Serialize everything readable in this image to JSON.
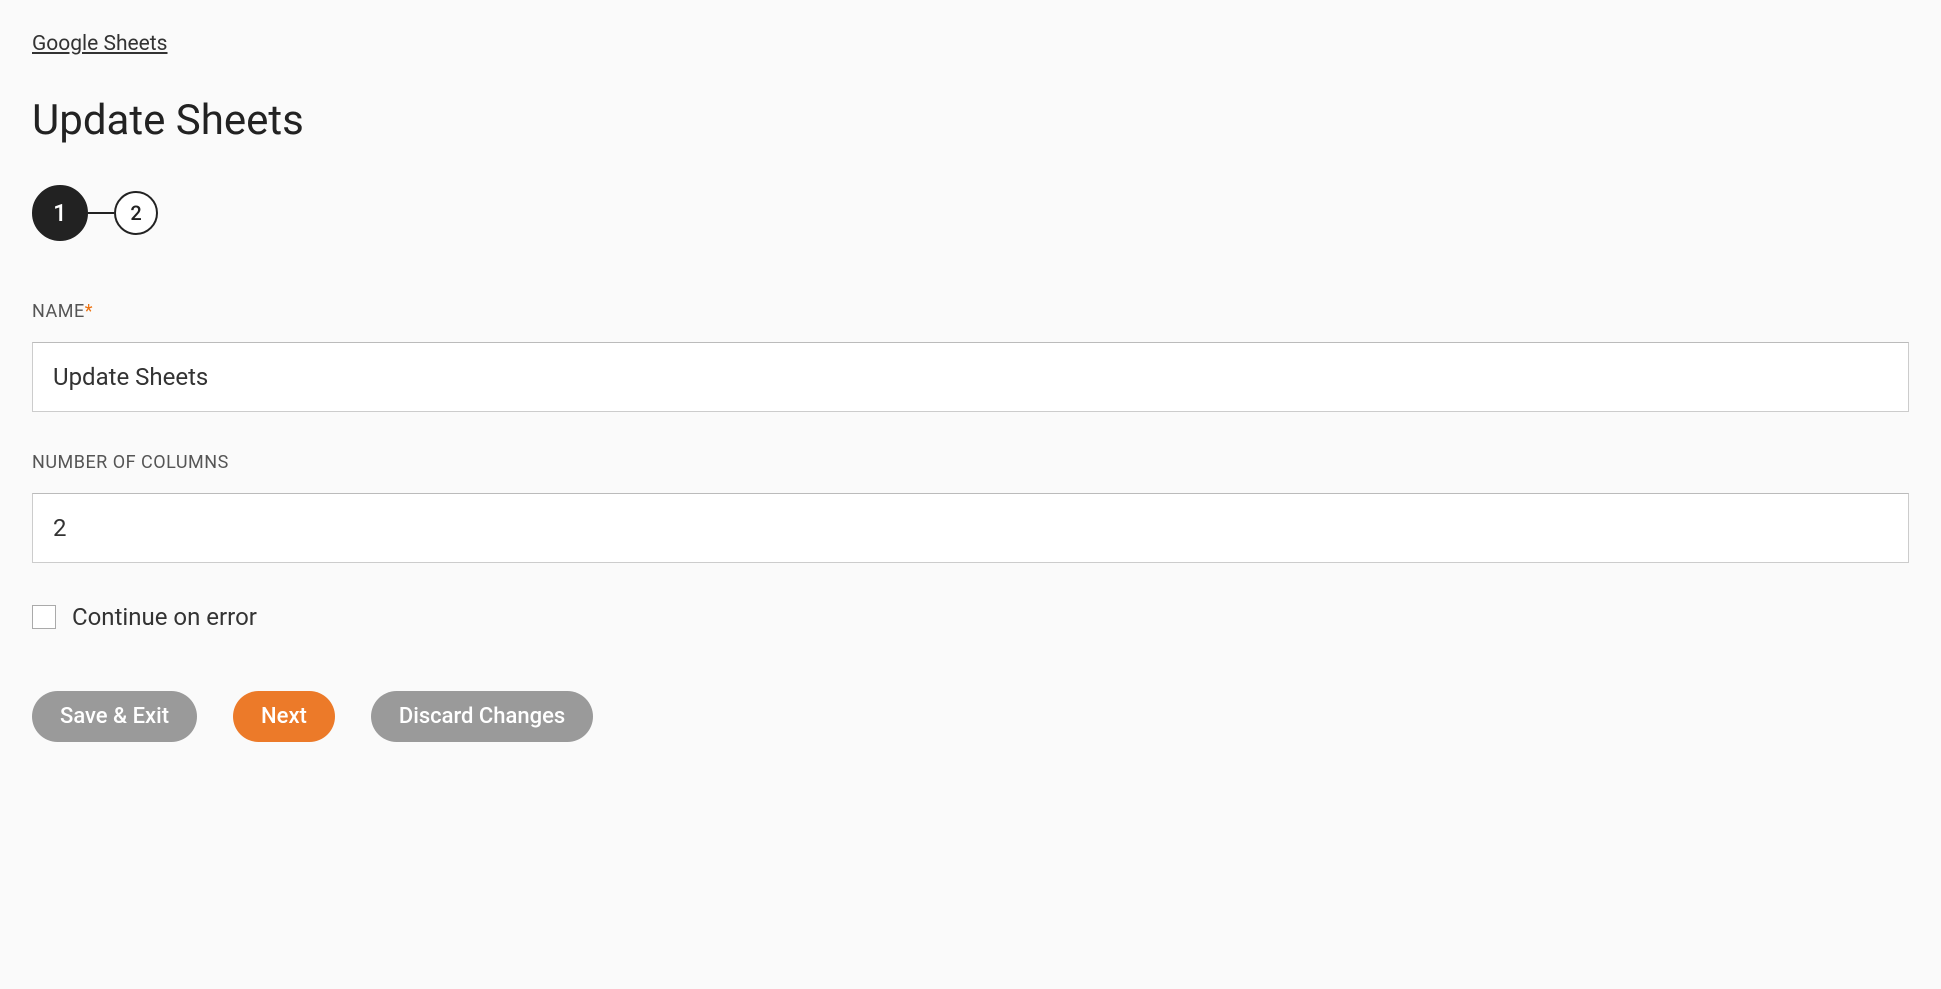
{
  "breadcrumb": {
    "link_text": "Google Sheets"
  },
  "page": {
    "title": "Update Sheets"
  },
  "stepper": {
    "step1": "1",
    "step2": "2"
  },
  "form": {
    "name": {
      "label": "NAME",
      "value": "Update Sheets"
    },
    "columns": {
      "label": "NUMBER OF COLUMNS",
      "value": "2"
    },
    "continue_on_error": {
      "label": "Continue on error"
    }
  },
  "buttons": {
    "save_exit": "Save & Exit",
    "next": "Next",
    "discard": "Discard Changes"
  }
}
